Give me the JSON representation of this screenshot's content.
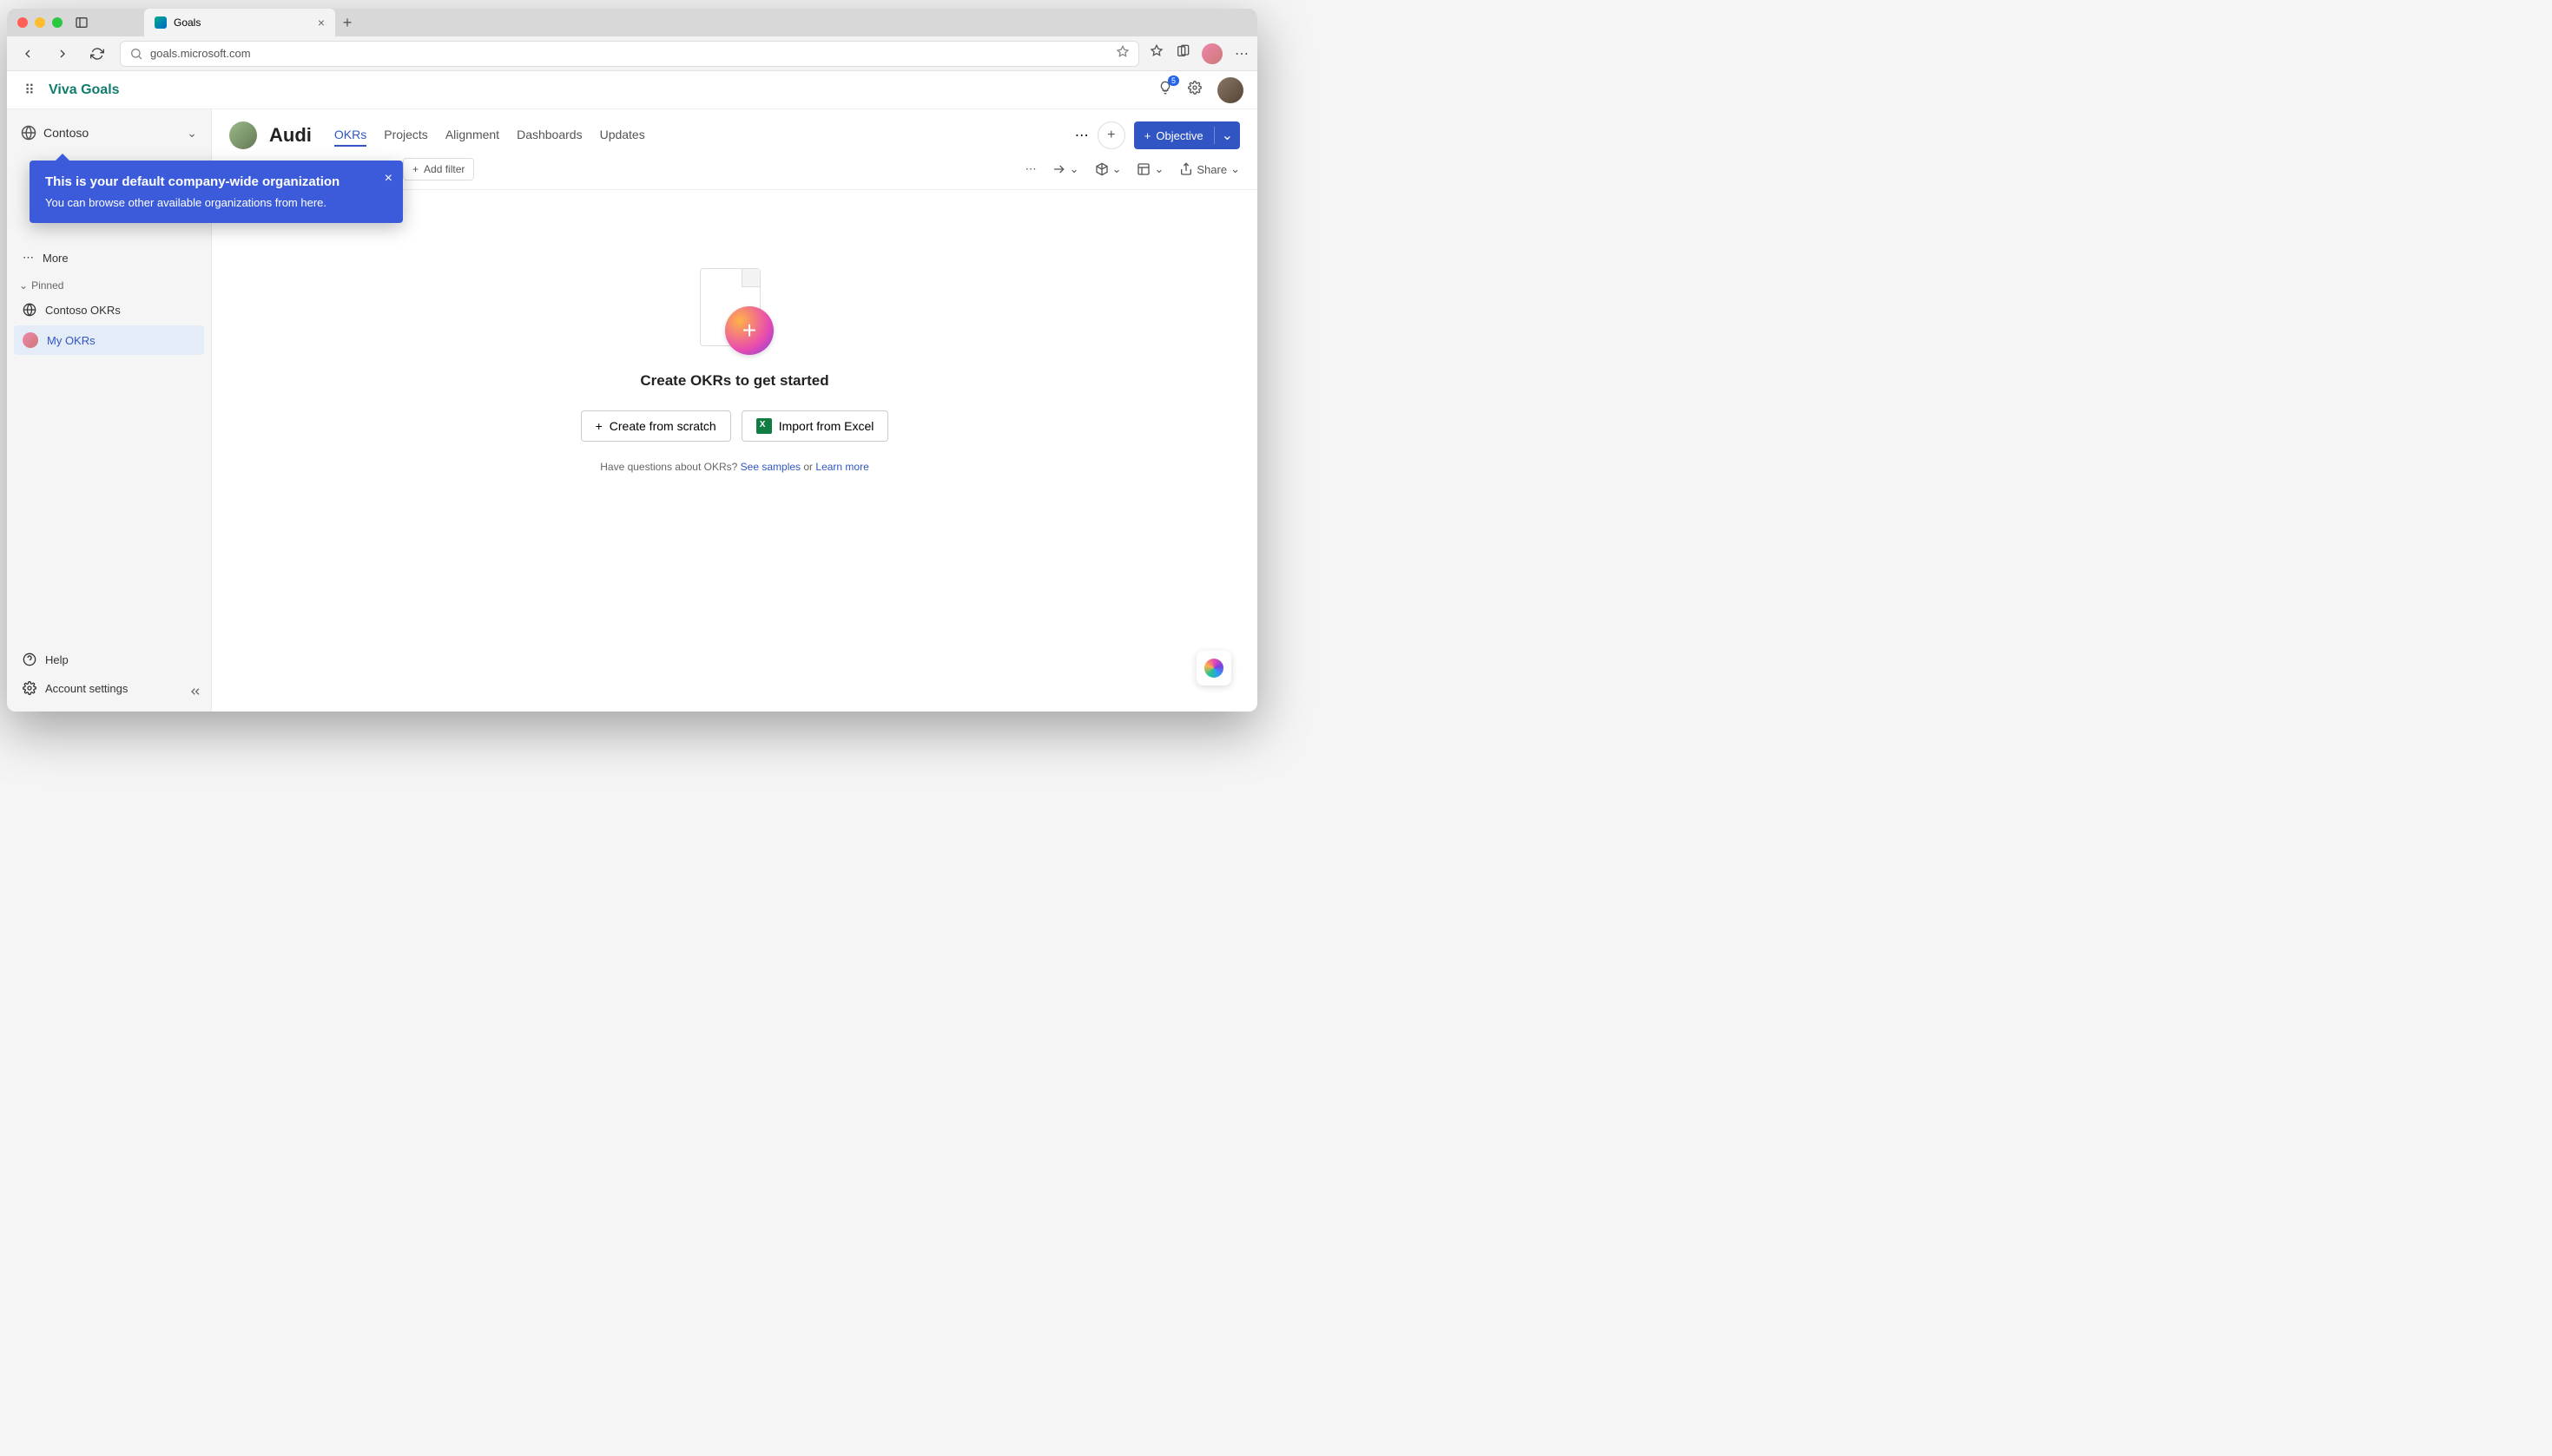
{
  "browser": {
    "tab_title": "Goals",
    "url": "goals.microsoft.com"
  },
  "app": {
    "brand": "Viva Goals",
    "notification_count": "5"
  },
  "sidebar": {
    "org_name": "Contoso",
    "more_label": "More",
    "pinned_label": "Pinned",
    "items": [
      {
        "label": "Contoso OKRs"
      },
      {
        "label": "My OKRs"
      }
    ],
    "help_label": "Help",
    "account_label": "Account settings"
  },
  "callout": {
    "title": "This is your default company-wide organization",
    "body": "You can browse other available organizations from here."
  },
  "main": {
    "title": "Audi",
    "tabs": [
      "OKRs",
      "Projects",
      "Alignment",
      "Dashboards",
      "Updates"
    ],
    "objective_btn": "Objective",
    "add_filter": "Add filter",
    "share_btn": "Share"
  },
  "empty": {
    "heading": "Create OKRs to get started",
    "create_btn": "Create from scratch",
    "import_btn": "Import from Excel",
    "help_prefix": "Have questions about OKRs? ",
    "see_samples": "See samples",
    "or": " or ",
    "learn_more": "Learn more"
  }
}
